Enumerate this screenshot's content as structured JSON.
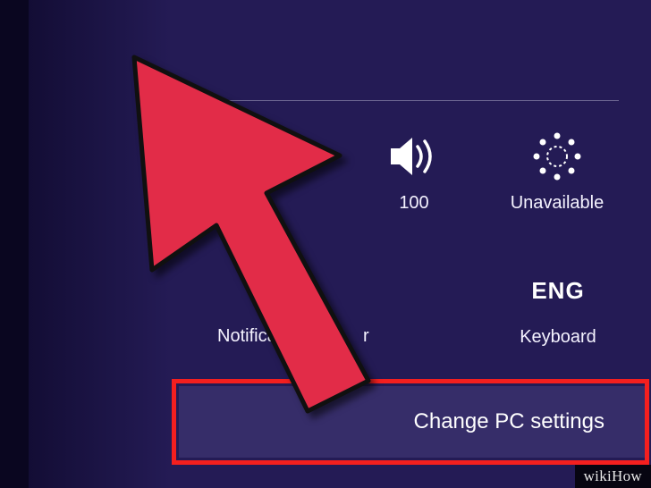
{
  "settings": {
    "volume": {
      "label": "100"
    },
    "brightness": {
      "label": "Unavailable"
    },
    "notifications": {
      "label_left": "Notifica",
      "label_right": "r"
    },
    "language": {
      "code": "ENG",
      "label": "Keyboard"
    }
  },
  "change_pc_settings": "Change PC settings",
  "watermark": "wikiHow"
}
